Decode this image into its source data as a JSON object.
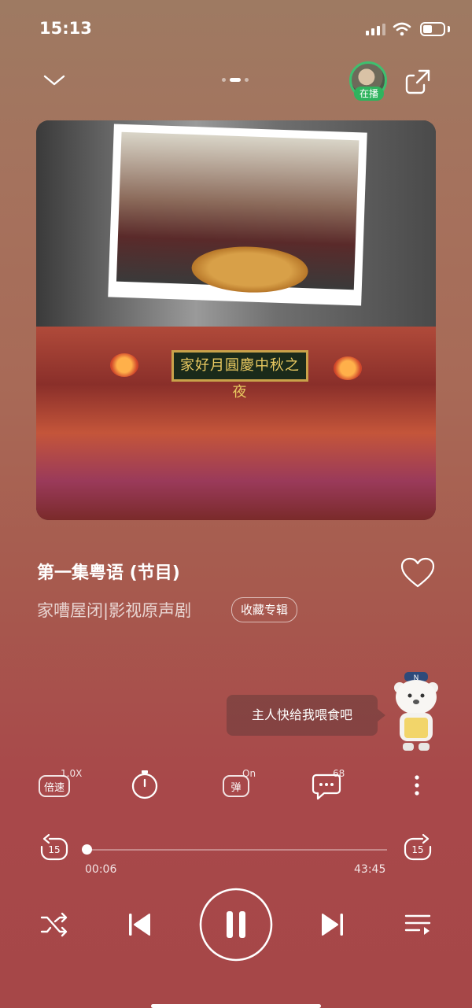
{
  "status_bar": {
    "time": "15:13"
  },
  "header": {
    "playing_badge": "在播"
  },
  "cover": {
    "banner_text": "家好月圓慶中秋之夜"
  },
  "song": {
    "title": "第一集粤语 (节目)",
    "album_line": "家嘈屋闭|影视原声剧",
    "collect_label": "收藏专辑"
  },
  "mascot": {
    "speech": "主人快给我喂食吧"
  },
  "tools": {
    "speed_label": "倍速",
    "speed_value": "1.0X",
    "danmaku_label": "弹",
    "danmaku_state": "On",
    "comment_count": "68"
  },
  "progress": {
    "current": "00:06",
    "total": "43:45",
    "fraction": 0.002,
    "skip_back": "15",
    "skip_forward": "15"
  },
  "colors": {
    "accent_green": "#2fb35e",
    "background_top": "#9e7a62",
    "background_bottom": "#a64748"
  }
}
